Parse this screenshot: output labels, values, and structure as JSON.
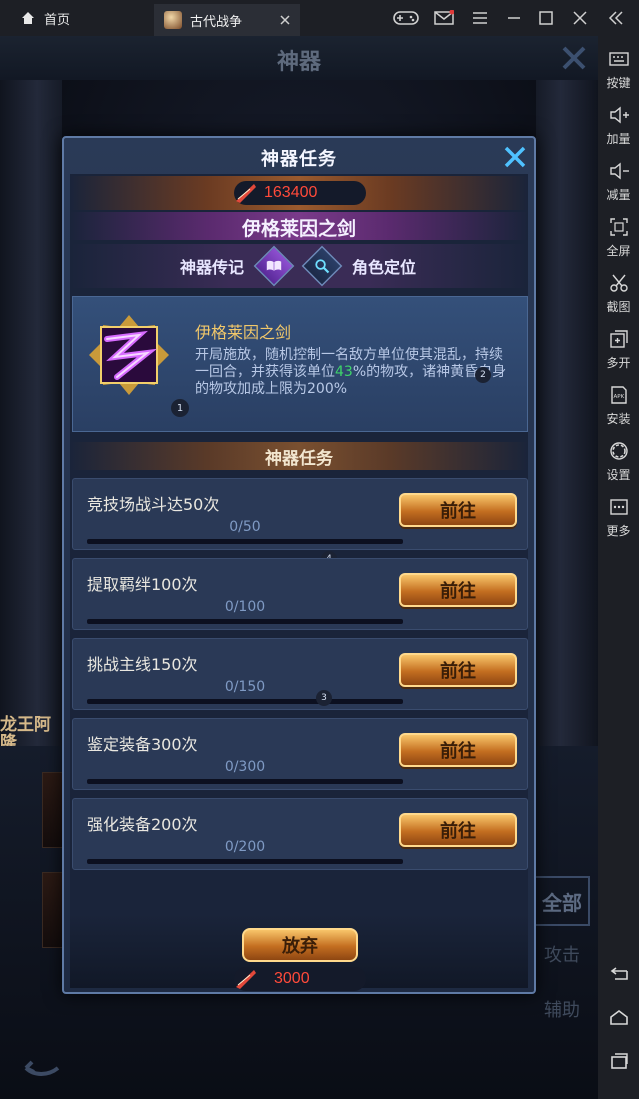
{
  "emulator": {
    "home_tab": "首页",
    "game_tab": "古代战争"
  },
  "toolbar": {
    "items": [
      {
        "icon": "keyboard-icon",
        "label": "按键"
      },
      {
        "icon": "volume-up-icon",
        "label": "加量"
      },
      {
        "icon": "volume-down-icon",
        "label": "减量"
      },
      {
        "icon": "fullscreen-icon",
        "label": "全屏"
      },
      {
        "icon": "scissors-icon",
        "label": "截图"
      },
      {
        "icon": "multi-open-icon",
        "label": "多开"
      },
      {
        "icon": "apk-icon",
        "label": "安装"
      },
      {
        "icon": "gear-icon",
        "label": "设置"
      },
      {
        "icon": "more-icon",
        "label": "更多"
      }
    ]
  },
  "background": {
    "title": "神器",
    "left_hero_name": "龙王阿隆",
    "filter_all": "全部",
    "filter_attack": "攻击",
    "filter_support": "辅助"
  },
  "modal": {
    "title": "神器任务",
    "currency_value": "163400",
    "artifact_name": "伊格莱因之剑",
    "tab_lore": "神器传记",
    "tab_role": "角色定位",
    "info": {
      "name": "伊格莱因之剑",
      "desc_part1": "开局施放，随机控制一名敌方单位使其混乱，持续一回合，并获得该单位",
      "desc_highlight": "43",
      "desc_part2": "%的物攻，诸神黄昏自身的物攻加成上限为200%",
      "icon_badge": "1",
      "badge2": "2"
    },
    "section_title": "神器任务",
    "tasks": [
      {
        "label": "竞技场战斗达50次",
        "progress": "0/50",
        "fraction": 0,
        "button": "前往"
      },
      {
        "label": "提取羁绊100次",
        "progress": "0/100",
        "fraction": 0,
        "button": "前往"
      },
      {
        "label": "挑战主线150次",
        "progress": "0/150",
        "fraction": 0,
        "button": "前往"
      },
      {
        "label": "鉴定装备300次",
        "progress": "0/300",
        "fraction": 0,
        "button": "前往"
      },
      {
        "label": "强化装备200次",
        "progress": "0/200",
        "fraction": 0,
        "button": "前往"
      }
    ],
    "badge4": "4",
    "badge3": "3",
    "abandon_label": "放弃",
    "abandon_cost": "3000"
  }
}
